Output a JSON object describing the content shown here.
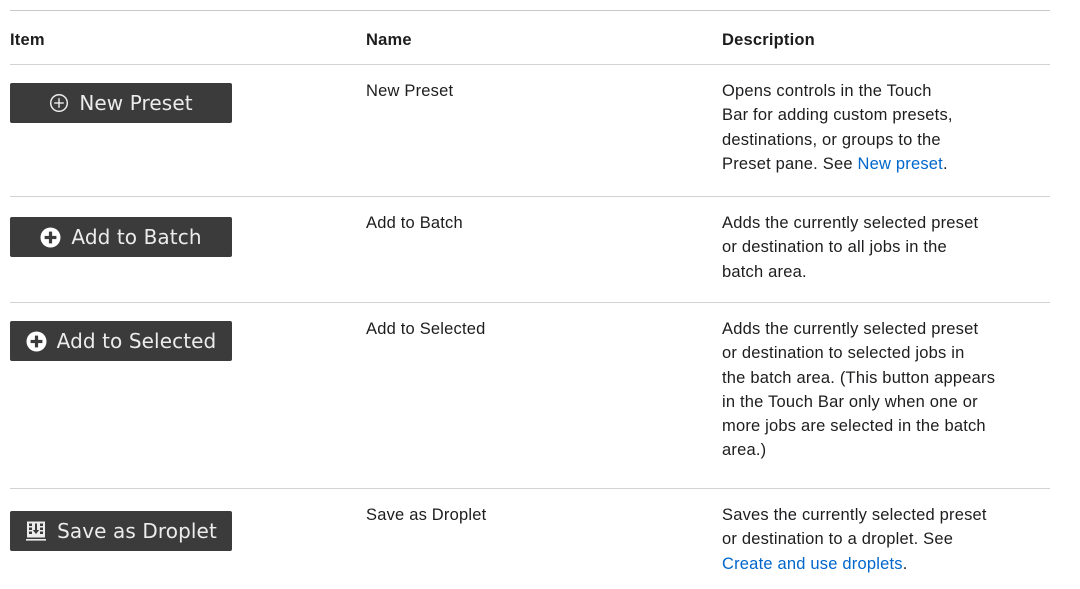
{
  "headers": {
    "item": "Item",
    "name": "Name",
    "description": "Description"
  },
  "rows": [
    {
      "button_label": "New Preset",
      "icon": "circle-plus-outline-icon",
      "name": "New Preset",
      "desc_lines": [
        "Opens controls in the Touch",
        "Bar for adding custom presets,",
        "destinations, or groups to the"
      ],
      "desc_last_prefix": "Preset pane. See ",
      "link": "New preset",
      "desc_last_suffix": "."
    },
    {
      "button_label": "Add to Batch",
      "icon": "circle-plus-filled-icon",
      "name": "Add to Batch",
      "desc_lines": [
        "Adds the currently selected preset",
        "or destination to all jobs in the",
        "batch area."
      ]
    },
    {
      "button_label": "Add to Selected",
      "icon": "circle-plus-filled-icon",
      "name": "Add to Selected",
      "desc_lines": [
        "Adds the currently selected preset",
        "or destination to selected jobs in",
        "the batch area. (This button appears",
        "in the Touch Bar only when one or",
        "more jobs are selected in the batch",
        "area.)"
      ]
    },
    {
      "button_label": "Save as Droplet",
      "icon": "droplet-download-icon",
      "name": "Save as Droplet",
      "desc_lines": [
        "Saves the currently selected preset",
        "or destination to a droplet. See"
      ],
      "link": "Create and use droplets",
      "desc_last_suffix": "."
    }
  ],
  "colors": {
    "button_bg": "#3b3b3b",
    "button_text": "#ececec",
    "link": "#0066cc",
    "rule": "#d2d2d7"
  }
}
